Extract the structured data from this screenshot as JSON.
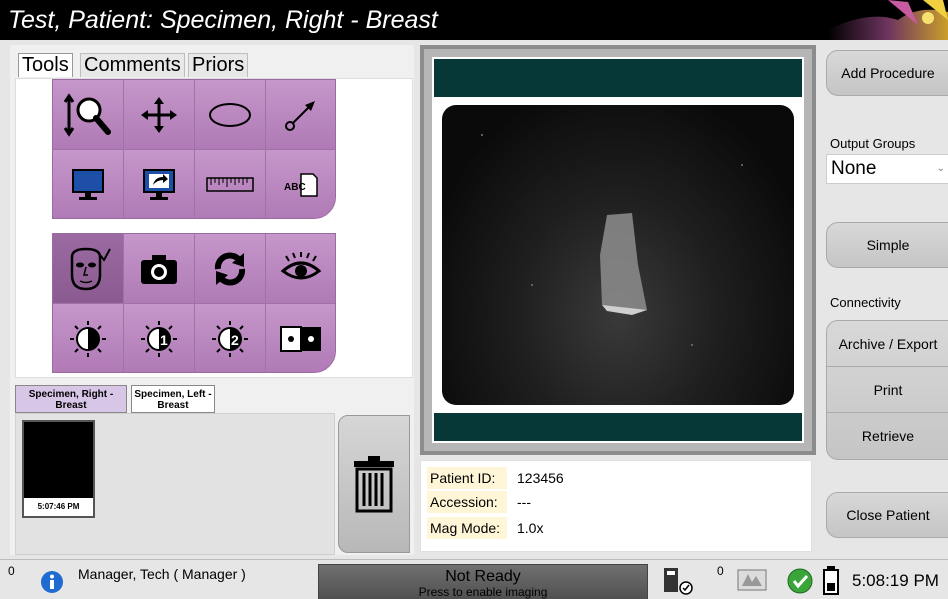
{
  "title": "Test, Patient:  Specimen, Right - Breast",
  "tabs": [
    "Tools",
    "Comments",
    "Priors"
  ],
  "tool_icons": {
    "row1": [
      "magnify-icon",
      "pan-icon",
      "ellipse-icon",
      "arrow-icon"
    ],
    "row2": [
      "monitor-icon",
      "send-monitor-icon",
      "ruler-icon",
      "text-annotation-icon"
    ],
    "row3": [
      "face-review-icon",
      "camera-icon",
      "refresh-icon",
      "eye-icon"
    ],
    "row4": [
      "window-level-icon",
      "window-level-1-icon",
      "window-level-2-icon",
      "invert-icon"
    ]
  },
  "text_tool_label": "ABC",
  "wl_numbers": [
    "1",
    "2"
  ],
  "sub_tabs": [
    "Specimen, Right - Breast",
    "Specimen, Left - Breast"
  ],
  "thumbnail_time": "5:07:46 PM",
  "patient_info": {
    "patient_id_label": "Patient ID:",
    "patient_id": "123456",
    "accession_label": "Accession:",
    "accession": "---",
    "mag_mode_label": "Mag Mode:",
    "mag_mode": "1.0x"
  },
  "right_panel": {
    "add_procedure": "Add Procedure",
    "output_groups_label": "Output Groups",
    "output_groups_value": "None",
    "simple": "Simple",
    "connectivity_label": "Connectivity",
    "archive_export": "Archive / Export",
    "print": "Print",
    "retrieve": "Retrieve",
    "close_patient": "Close Patient"
  },
  "statusbar": {
    "count_left": "0",
    "user": "Manager, Tech ( Manager )",
    "not_ready": "Not Ready",
    "not_ready_sub": "Press to enable imaging",
    "count_right": "0",
    "time": "5:08:19 PM"
  },
  "colors": {
    "tool_purple": "#b984be",
    "viewer_teal": "#063838",
    "info_label_bg": "#fff6d8"
  }
}
